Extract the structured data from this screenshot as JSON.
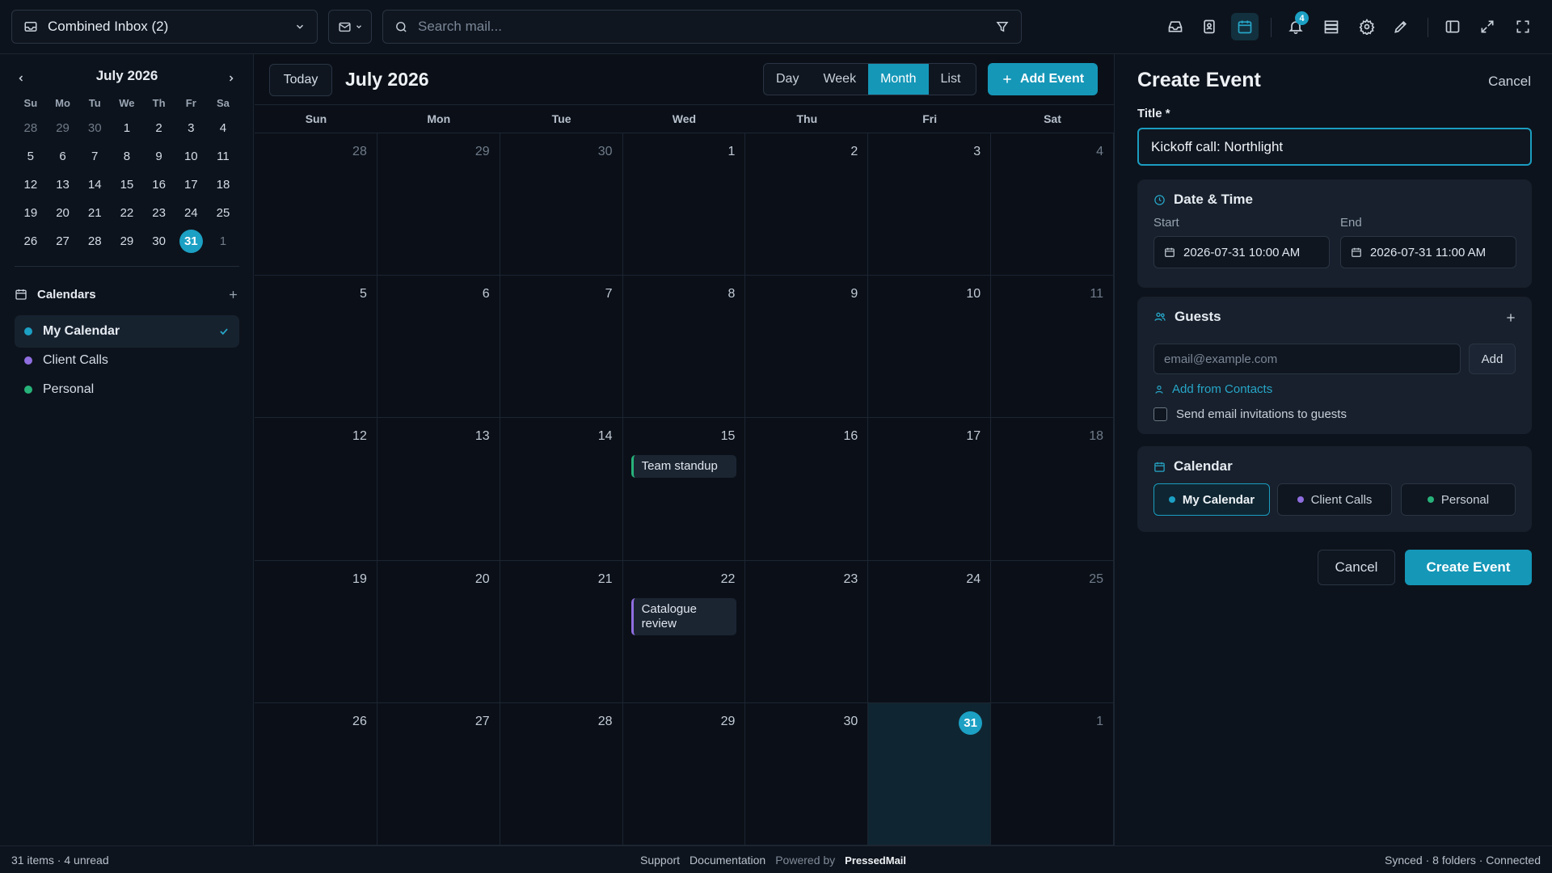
{
  "topbar": {
    "inbox_label": "Combined Inbox (2)",
    "search_placeholder": "Search mail...",
    "notification_count": "4"
  },
  "mini_calendar": {
    "title": "July 2026",
    "weekdays": [
      "Su",
      "Mo",
      "Tu",
      "We",
      "Th",
      "Fr",
      "Sa"
    ],
    "days": [
      {
        "label": "28",
        "out": true
      },
      {
        "label": "29",
        "out": true
      },
      {
        "label": "30",
        "out": true
      },
      {
        "label": "1"
      },
      {
        "label": "2"
      },
      {
        "label": "3"
      },
      {
        "label": "4"
      },
      {
        "label": "5"
      },
      {
        "label": "6"
      },
      {
        "label": "7"
      },
      {
        "label": "8"
      },
      {
        "label": "9"
      },
      {
        "label": "10"
      },
      {
        "label": "11"
      },
      {
        "label": "12"
      },
      {
        "label": "13"
      },
      {
        "label": "14"
      },
      {
        "label": "15"
      },
      {
        "label": "16"
      },
      {
        "label": "17"
      },
      {
        "label": "18"
      },
      {
        "label": "19"
      },
      {
        "label": "20"
      },
      {
        "label": "21"
      },
      {
        "label": "22"
      },
      {
        "label": "23"
      },
      {
        "label": "24"
      },
      {
        "label": "25"
      },
      {
        "label": "26"
      },
      {
        "label": "27"
      },
      {
        "label": "28"
      },
      {
        "label": "29"
      },
      {
        "label": "30"
      },
      {
        "label": "31",
        "today": true
      },
      {
        "label": "1",
        "out": true
      }
    ]
  },
  "calendars": {
    "heading": "Calendars",
    "items": [
      {
        "label": "My Calendar",
        "color": "#1ca0c4",
        "selected": true
      },
      {
        "label": "Client Calls",
        "color": "#8f6ee0",
        "selected": false
      },
      {
        "label": "Personal",
        "color": "#27b27a",
        "selected": false
      }
    ]
  },
  "main": {
    "today_label": "Today",
    "month_title": "July 2026",
    "views": [
      "Day",
      "Week",
      "Month",
      "List"
    ],
    "active_view": "Month",
    "add_event_label": "Add Event",
    "weekdays": [
      "Sun",
      "Mon",
      "Tue",
      "Wed",
      "Thu",
      "Fri",
      "Sat"
    ],
    "weeks": [
      [
        {
          "label": "28",
          "out": true
        },
        {
          "label": "29",
          "out": true
        },
        {
          "label": "30",
          "out": true
        },
        {
          "label": "1"
        },
        {
          "label": "2"
        },
        {
          "label": "3"
        },
        {
          "label": "4",
          "out": true
        }
      ],
      [
        {
          "label": "5"
        },
        {
          "label": "6"
        },
        {
          "label": "7"
        },
        {
          "label": "8"
        },
        {
          "label": "9"
        },
        {
          "label": "10"
        },
        {
          "label": "11",
          "out": true
        }
      ],
      [
        {
          "label": "12"
        },
        {
          "label": "13"
        },
        {
          "label": "14"
        },
        {
          "label": "15",
          "events": [
            {
              "title": "Team standup",
              "color": "#27b27a"
            }
          ]
        },
        {
          "label": "16"
        },
        {
          "label": "17"
        },
        {
          "label": "18",
          "out": true
        }
      ],
      [
        {
          "label": "19"
        },
        {
          "label": "20"
        },
        {
          "label": "21"
        },
        {
          "label": "22",
          "events": [
            {
              "title": "Catalogue review",
              "color": "#8f6ee0"
            }
          ]
        },
        {
          "label": "23"
        },
        {
          "label": "24"
        },
        {
          "label": "25",
          "out": true
        }
      ],
      [
        {
          "label": "26"
        },
        {
          "label": "27"
        },
        {
          "label": "28"
        },
        {
          "label": "29"
        },
        {
          "label": "30"
        },
        {
          "label": "31",
          "today": true
        },
        {
          "label": "1",
          "out": true
        }
      ]
    ]
  },
  "panel": {
    "title": "Create Event",
    "cancel_top": "Cancel",
    "title_label": "Title *",
    "title_value": "Kickoff call: Northlight",
    "datetime": {
      "heading": "Date & Time",
      "start_label": "Start",
      "start_value": "2026-07-31 10:00 AM",
      "end_label": "End",
      "end_value": "2026-07-31 11:00 AM"
    },
    "guests": {
      "heading": "Guests",
      "placeholder": "email@example.com",
      "add_label": "Add",
      "contacts_link": "Add from Contacts",
      "invite_label": "Send email invitations to guests"
    },
    "calendar": {
      "heading": "Calendar",
      "options": [
        {
          "label": "My Calendar",
          "color": "#1ca0c4",
          "selected": true
        },
        {
          "label": "Client Calls",
          "color": "#8f6ee0",
          "selected": false
        },
        {
          "label": "Personal",
          "color": "#27b27a",
          "selected": false
        }
      ]
    },
    "cancel_label": "Cancel",
    "create_label": "Create Event"
  },
  "statusbar": {
    "left": "31 items · 4 unread",
    "support": "Support",
    "documentation": "Documentation",
    "powered_by": "Powered by",
    "brand": "PressedMail",
    "right": "Synced · 8 folders · Connected"
  },
  "colors": {
    "accent": "#1597b8",
    "today": "#1ca0c4",
    "background": "#0b1018"
  }
}
